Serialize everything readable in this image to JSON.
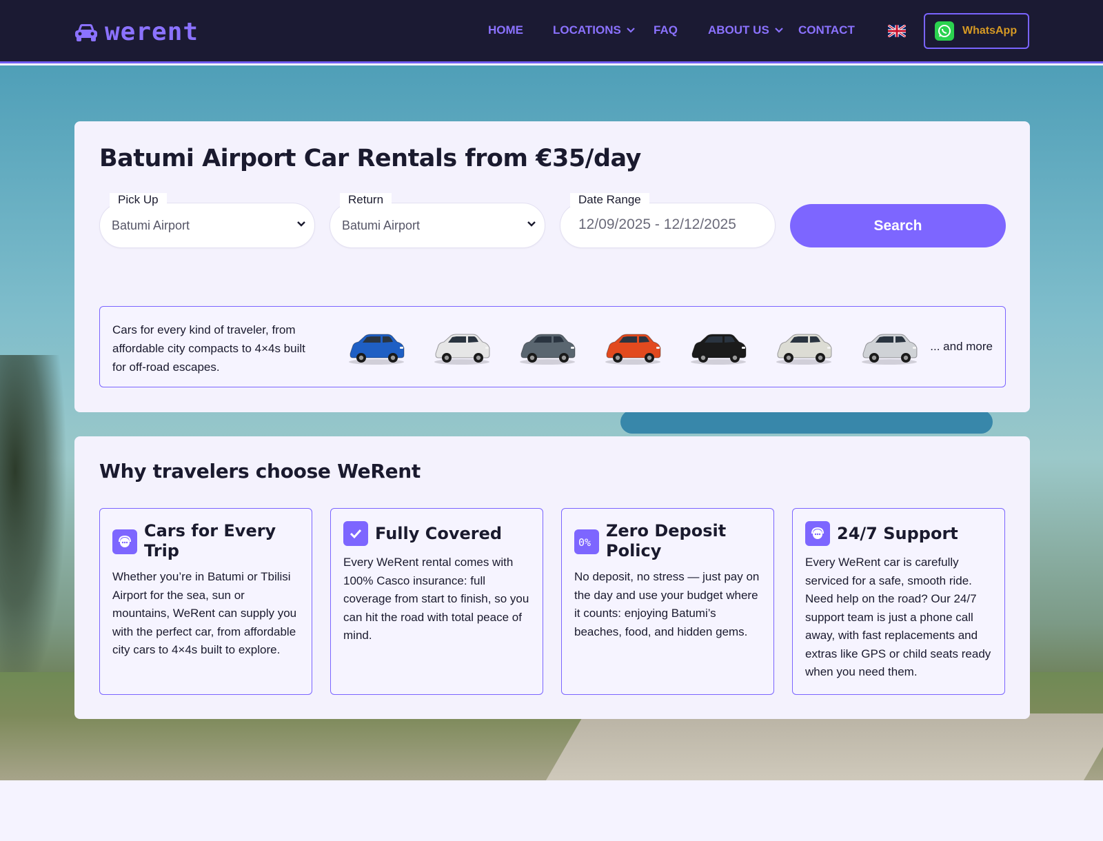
{
  "brand": {
    "name": "werent"
  },
  "nav": {
    "items": [
      {
        "label": "HOME",
        "dropdown": false
      },
      {
        "label": "LOCATIONS",
        "dropdown": true
      },
      {
        "label": "FAQ",
        "dropdown": false
      },
      {
        "label": "ABOUT US",
        "dropdown": true
      },
      {
        "label": "CONTACT",
        "dropdown": false
      }
    ],
    "language_icon": "uk-flag-icon",
    "whatsapp_label": "WhatsApp"
  },
  "search": {
    "title": "Batumi Airport Car Rentals from €35/day",
    "pickup": {
      "label": "Pick Up",
      "value": "Batumi Airport"
    },
    "return": {
      "label": "Return",
      "value": "Batumi Airport"
    },
    "date_range": {
      "label": "Date Range",
      "value": "12/09/2025 - 12/12/2025"
    },
    "button_label": "Search"
  },
  "fleet": {
    "text": "Cars for every kind of traveler, from affordable city compacts to 4×4s built for off-road escapes.",
    "more_label": "... and more",
    "cars": [
      {
        "name": "blue-suv",
        "color": "#1f5fc4"
      },
      {
        "name": "white-suv",
        "color": "#e6e6e6"
      },
      {
        "name": "grey-compact",
        "color": "#5a6670"
      },
      {
        "name": "orange-4x4",
        "color": "#e24a1f"
      },
      {
        "name": "black-jeep",
        "color": "#1b1b1b"
      },
      {
        "name": "white-4x4-tent",
        "color": "#dcdcd4"
      },
      {
        "name": "silver-hybrid",
        "color": "#cfd2d6"
      }
    ]
  },
  "why": {
    "title": "Why travelers choose WeRent",
    "features": [
      {
        "title": "Cars for Every Trip",
        "icon": "support-agent-icon",
        "body": "Whether you’re in Batumi or Tbilisi Airport for the sea, sun or mountains, WeRent can supply you with the perfect car, from affordable city cars to 4×4s built to explore."
      },
      {
        "title": "Fully Covered",
        "icon": "checkbox-icon",
        "body": "Every WeRent rental comes with 100% Casco insurance: full coverage from start to finish, so you can hit the road with total peace of mind."
      },
      {
        "title": "Zero Deposit Policy",
        "icon": "zero-percent-icon",
        "body": "No deposit, no stress — just pay on the day and use your budget where it counts: enjoying Batumi’s beaches, food, and hidden gems."
      },
      {
        "title": "24/7 Support",
        "icon": "support-agent-icon",
        "body": "Every WeRent car is carefully serviced for a safe, smooth ride. Need help on the road? Our 24/7 support team is just a phone call away, with fast replacements and extras like GPS or child seats ready when you need them."
      }
    ]
  },
  "colors": {
    "accent": "#7d66ff",
    "header_bg": "#1b1a33",
    "whatsapp_text": "#d79a24"
  }
}
